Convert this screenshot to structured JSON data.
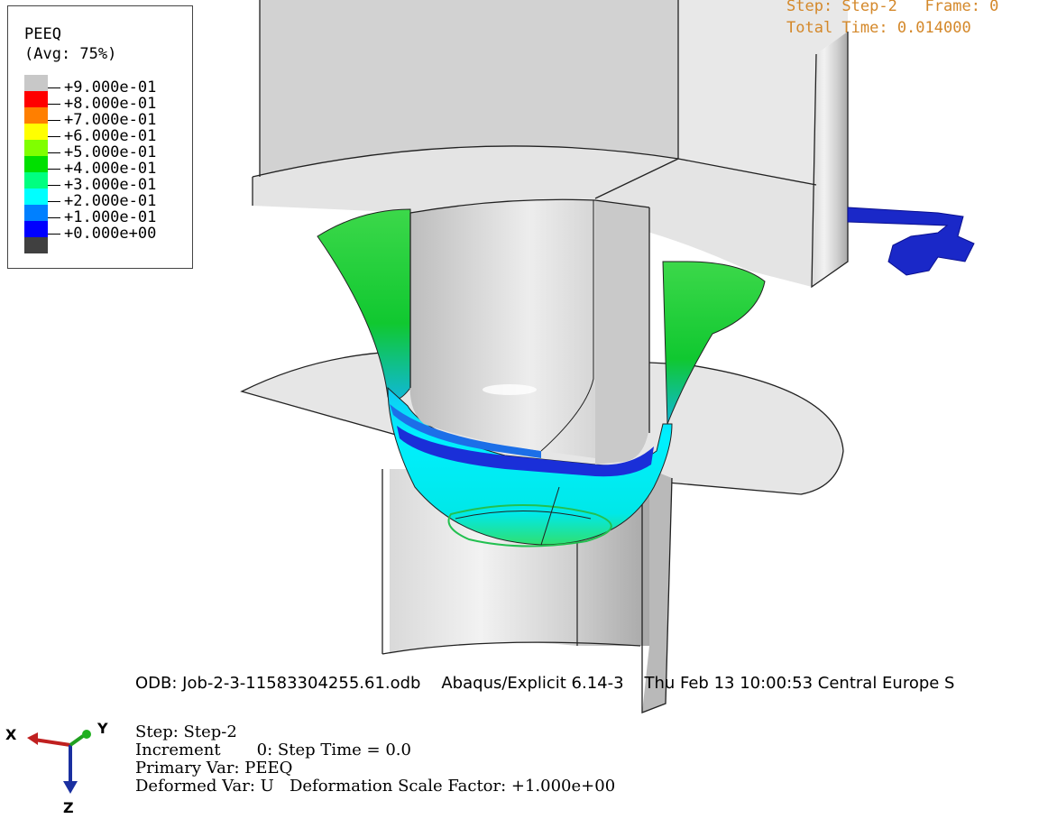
{
  "legend": {
    "title": "PEEQ",
    "subtitle": "(Avg: 75%)",
    "entries": [
      {
        "label": "+9.000e-01",
        "color": "#c8c8c8"
      },
      {
        "label": "+8.000e-01",
        "color": "#ff0000"
      },
      {
        "label": "+7.000e-01",
        "color": "#ff7f00"
      },
      {
        "label": "+6.000e-01",
        "color": "#ffff00"
      },
      {
        "label": "+5.000e-01",
        "color": "#80ff00"
      },
      {
        "label": "+4.000e-01",
        "color": "#00e000"
      },
      {
        "label": "+3.000e-01",
        "color": "#00ff80"
      },
      {
        "label": "+2.000e-01",
        "color": "#00ffff"
      },
      {
        "label": "+1.000e-01",
        "color": "#0080ff"
      },
      {
        "label": "+0.000e+00",
        "color": "#0000ff"
      }
    ],
    "bottom_color": "#404040"
  },
  "header": {
    "step_line": "Step: Step-2   Frame: 0",
    "time_line": "Total Time: 0.014000"
  },
  "footer": {
    "odb_line": "ODB: Job-2-3-11583304255.61.odb    Abaqus/Explicit 6.14-3    Thu Feb 13 10:00:53 Central Europe S",
    "step": "Step: Step-2",
    "increment": "Increment       0: Step Time = 0.0",
    "primary_var": "Primary Var: PEEQ",
    "deformed_var": "Deformed Var: U   Deformation Scale Factor: +1.000e+00"
  },
  "triad": {
    "x": "X",
    "y": "Y",
    "z": "Z"
  },
  "colors": {
    "header_text": "#d4882a",
    "background": "#ffffff"
  }
}
